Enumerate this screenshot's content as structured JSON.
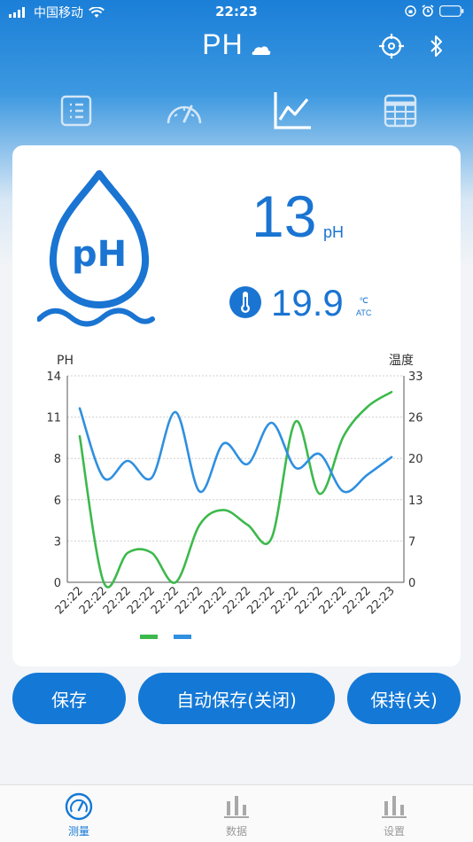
{
  "status_bar": {
    "carrier": "中国移动",
    "time": "22:23"
  },
  "header": {
    "title": "PH"
  },
  "mode_tabs": [
    {
      "icon": "list-icon",
      "active": false
    },
    {
      "icon": "gauge-icon",
      "active": false
    },
    {
      "icon": "line-chart-icon",
      "active": true
    },
    {
      "icon": "table-icon",
      "active": false
    }
  ],
  "reading": {
    "ph_logo_text": "pH",
    "ph_value": "13",
    "ph_unit": "pH",
    "temperature": "19.9",
    "temp_unit": "℃",
    "temp_mode": "ATC"
  },
  "chart_data": {
    "type": "line",
    "ylabel_left": "PH",
    "ylabel_right": "温度",
    "y_left_ticks": [
      "14",
      "11",
      "8",
      "6",
      "3",
      "0"
    ],
    "y_right_ticks": [
      "33",
      "26",
      "20",
      "13",
      "7",
      "0"
    ],
    "ylim_left": [
      0,
      14
    ],
    "ylim_right": [
      0,
      33
    ],
    "grid": true,
    "x_labels": [
      "22:22",
      "22:22",
      "22:22",
      "22:22",
      "22:22",
      "22:22",
      "22:22",
      "22:22",
      "22:22",
      "22:22",
      "22:22",
      "22:22",
      "22:22",
      "22:23"
    ],
    "series": [
      {
        "color": "#3cb94c",
        "axis": "left",
        "x": [
          0,
          1,
          2,
          3,
          4,
          5,
          6,
          7,
          8,
          9,
          10,
          11,
          12,
          13
        ],
        "values": [
          9.9,
          0.0,
          2.0,
          2.0,
          0.0,
          3.9,
          4.9,
          3.9,
          3.0,
          10.9,
          6.0,
          9.9,
          11.9,
          12.9
        ]
      },
      {
        "color": "#2f8fe0",
        "axis": "right",
        "x": [
          0,
          1,
          2,
          3,
          4,
          5,
          6,
          7,
          8,
          9,
          10,
          11,
          12,
          13
        ],
        "values": [
          27.8,
          16.7,
          19.4,
          16.7,
          27.2,
          14.5,
          22.2,
          18.9,
          25.5,
          18.3,
          20.5,
          14.5,
          17.2,
          20.0
        ]
      }
    ]
  },
  "buttons": {
    "save": "保存",
    "auto_save": "自动保存(关闭)",
    "hold": "保持(关)"
  },
  "tabbar": [
    {
      "label": "测量",
      "active": true
    },
    {
      "label": "数据",
      "active": false
    },
    {
      "label": "设置",
      "active": false
    }
  ],
  "colors": {
    "primary": "#1478d6",
    "green_series": "#3cb94c",
    "blue_series": "#2f8fe0",
    "inactive": "#9a9a9a"
  }
}
